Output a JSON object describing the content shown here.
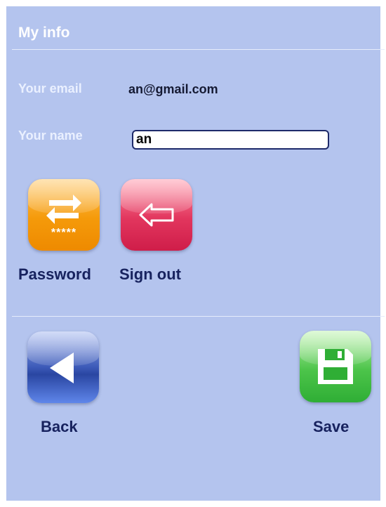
{
  "header": {
    "title": "My info"
  },
  "form": {
    "email_label": "Your email",
    "email_value": "an@gmail.com",
    "name_label": "Your name",
    "name_value": "an"
  },
  "actions": {
    "password_label": "Password",
    "password_stars": "*****",
    "signout_label": "Sign out"
  },
  "footer": {
    "back_label": "Back",
    "save_label": "Save"
  },
  "colors": {
    "background": "#b4c4ee",
    "password_button": "#f59a0a",
    "signout_button": "#e2365e",
    "back_button": "#3c5ab8",
    "save_button": "#4cc44a"
  }
}
